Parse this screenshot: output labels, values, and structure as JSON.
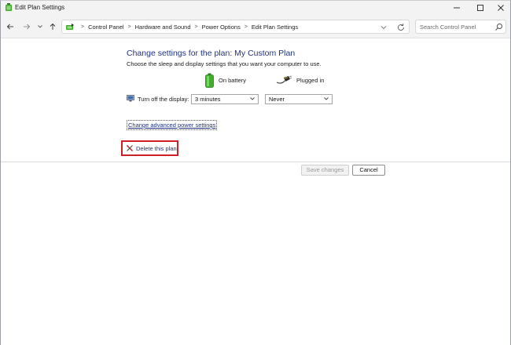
{
  "window": {
    "title": "Edit Plan Settings"
  },
  "nav": {
    "breadcrumbs": [
      "Control Panel",
      "Hardware and Sound",
      "Power Options",
      "Edit Plan Settings"
    ],
    "search_placeholder": "Search Control Panel"
  },
  "main": {
    "heading": "Change settings for the plan: My Custom Plan",
    "subtext": "Choose the sleep and display settings that you want your computer to use.",
    "columns": {
      "battery_label": "On battery",
      "plugged_label": "Plugged in"
    },
    "display_setting": {
      "label": "Turn off the display:",
      "battery_value": "3 minutes",
      "plugged_value": "Never"
    },
    "advanced_link": "Change advanced power settings",
    "delete_link": "Delete this plan",
    "buttons": {
      "save": "Save changes",
      "cancel": "Cancel"
    }
  },
  "icons": {
    "app": "power-options-icon",
    "address": "power-options-icon",
    "battery": "battery-icon",
    "plugged": "power-plug-icon",
    "display": "monitor-icon",
    "delete": "delete-x-icon",
    "search": "search-icon"
  },
  "colors": {
    "heading_link": "#1e3287",
    "highlight_box": "#cc1f26",
    "battery_green": "#3fae2a"
  }
}
